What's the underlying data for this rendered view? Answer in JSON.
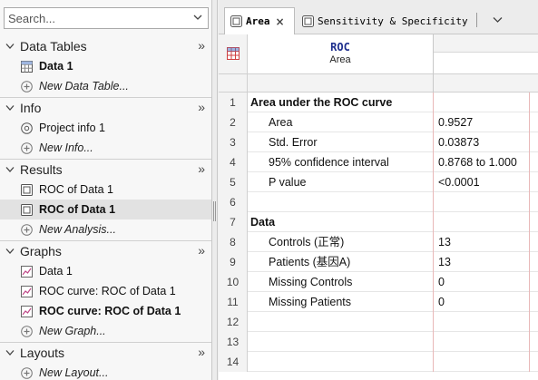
{
  "search": {
    "placeholder": "Search..."
  },
  "sidebar": {
    "sections": [
      {
        "title": "Data Tables",
        "more": "»",
        "items": [
          {
            "label": "Data 1",
            "icon": "data-table-icon",
            "bold": true
          },
          {
            "label": "New Data Table...",
            "icon": "plus-circle-icon",
            "new": true
          }
        ]
      },
      {
        "title": "Info",
        "more": "»",
        "items": [
          {
            "label": "Project info 1",
            "icon": "info-icon"
          },
          {
            "label": "New Info...",
            "icon": "plus-circle-icon",
            "new": true
          }
        ]
      },
      {
        "title": "Results",
        "more": "»",
        "items": [
          {
            "label": "ROC of Data 1",
            "icon": "results-sheet-icon"
          },
          {
            "label": "ROC of Data 1",
            "icon": "results-sheet-icon",
            "bold": true,
            "selected": true
          },
          {
            "label": "New Analysis...",
            "icon": "plus-circle-icon",
            "new": true
          }
        ]
      },
      {
        "title": "Graphs",
        "more": "»",
        "items": [
          {
            "label": "Data 1",
            "icon": "graph-icon"
          },
          {
            "label": "ROC curve: ROC of Data 1",
            "icon": "graph-icon"
          },
          {
            "label": "ROC curve: ROC of Data 1",
            "icon": "graph-icon",
            "bold": true
          },
          {
            "label": "New Graph...",
            "icon": "plus-circle-icon",
            "new": true
          }
        ]
      },
      {
        "title": "Layouts",
        "more": "»",
        "items": [
          {
            "label": "New Layout...",
            "icon": "plus-circle-icon",
            "new": true
          }
        ]
      }
    ]
  },
  "tabs": [
    {
      "label": "Area",
      "icon": "results-sheet-icon",
      "active": true,
      "close": "×"
    },
    {
      "label": "Sensitivity & Specificity",
      "icon": "results-sheet-icon",
      "active": false
    }
  ],
  "sheet": {
    "column_a": {
      "title": "ROC",
      "subtitle": "Area"
    },
    "rows": [
      {
        "n": "1",
        "a": "Area under the ROC curve",
        "b": "",
        "style": "h"
      },
      {
        "n": "2",
        "a": "Area",
        "b": "0.9527",
        "style": "s"
      },
      {
        "n": "3",
        "a": "Std. Error",
        "b": "0.03873",
        "style": "s"
      },
      {
        "n": "4",
        "a": "95% confidence interval",
        "b": "0.8768 to 1.000",
        "style": "s"
      },
      {
        "n": "5",
        "a": "P value",
        "b": "<0.0001",
        "style": "s"
      },
      {
        "n": "6",
        "a": "",
        "b": "",
        "style": "s"
      },
      {
        "n": "7",
        "a": "Data",
        "b": "",
        "style": "h"
      },
      {
        "n": "8",
        "a": "Controls (正常)",
        "b": "13",
        "style": "s"
      },
      {
        "n": "9",
        "a": "Patients (基因A)",
        "b": "13",
        "style": "s"
      },
      {
        "n": "10",
        "a": "Missing Controls",
        "b": "0",
        "style": "s"
      },
      {
        "n": "11",
        "a": "Missing Patients",
        "b": "0",
        "style": "s"
      },
      {
        "n": "12",
        "a": "",
        "b": "",
        "style": "s"
      },
      {
        "n": "13",
        "a": "",
        "b": "",
        "style": "s"
      },
      {
        "n": "14",
        "a": "",
        "b": "",
        "style": "s"
      }
    ]
  },
  "colors": {
    "column_title": "#1c2d8c",
    "column_rule": "#e8b8b8",
    "selection": "#e2e2e2"
  }
}
